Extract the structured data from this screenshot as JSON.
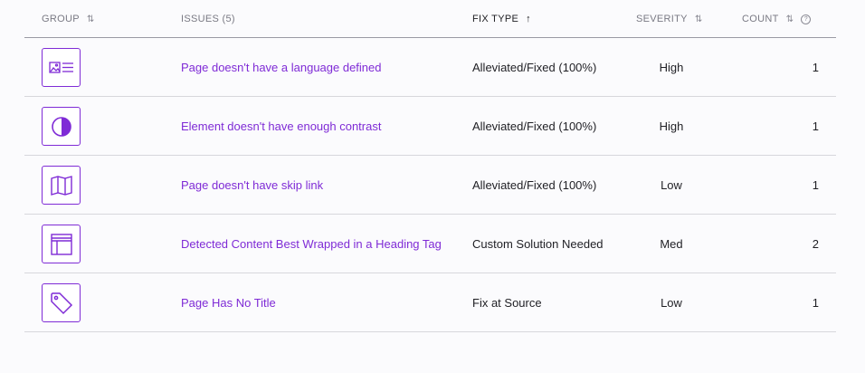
{
  "header": {
    "group": "GROUP",
    "issues": "ISSUES (5)",
    "fix_type": "FIX TYPE",
    "severity": "SEVERITY",
    "count": "COUNT",
    "sort_icon": "⇅",
    "sort_asc_icon": "↑",
    "help_icon": "?"
  },
  "colors": {
    "accent": "#7f2bd6",
    "divider": "#d7d7dc"
  },
  "rows": [
    {
      "icon": "image-text-icon",
      "issue": "Page doesn't have a language defined",
      "fix": "Alleviated/Fixed (100%)",
      "severity": "High",
      "count": "1"
    },
    {
      "icon": "contrast-icon",
      "issue": "Element doesn't have enough contrast",
      "fix": "Alleviated/Fixed (100%)",
      "severity": "High",
      "count": "1"
    },
    {
      "icon": "map-icon",
      "issue": "Page doesn't have skip link",
      "fix": "Alleviated/Fixed (100%)",
      "severity": "Low",
      "count": "1"
    },
    {
      "icon": "layout-icon",
      "issue": "Detected Content Best Wrapped in a Heading Tag",
      "fix": "Custom Solution Needed",
      "severity": "Med",
      "count": "2"
    },
    {
      "icon": "tag-icon",
      "issue": "Page Has No Title",
      "fix": "Fix at Source",
      "severity": "Low",
      "count": "1"
    }
  ]
}
